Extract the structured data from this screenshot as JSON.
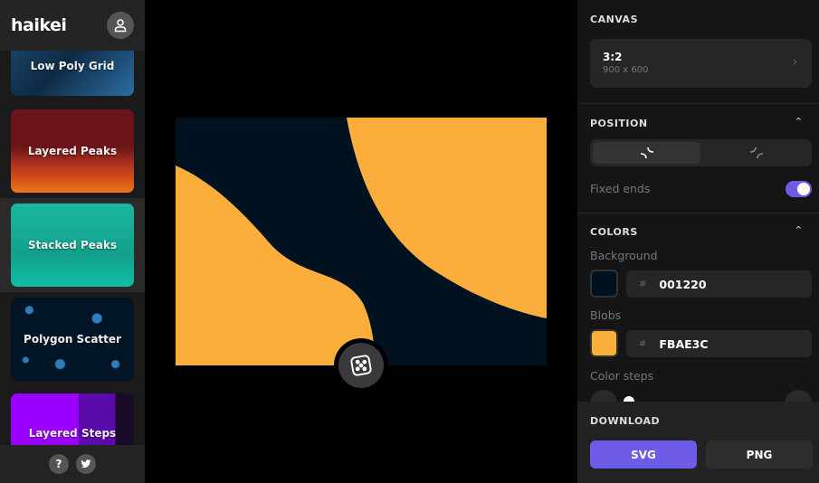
{
  "app": {
    "logo": "haikei"
  },
  "sidebar": {
    "items": [
      {
        "label": "Low Poly Grid"
      },
      {
        "label": "Layered Peaks"
      },
      {
        "label": "Stacked Peaks"
      },
      {
        "label": "Polygon Scatter"
      },
      {
        "label": "Layered Steps"
      }
    ],
    "help": "?"
  },
  "panel": {
    "canvas": {
      "title": "CANVAS",
      "ratio": "3:2",
      "size": "900 x 600"
    },
    "position": {
      "title": "POSITION",
      "fixed_ends": "Fixed ends",
      "fixed_ends_on": true
    },
    "colors": {
      "title": "COLORS",
      "background_label": "Background",
      "background": "001220",
      "blobs_label": "Blobs",
      "blobs": "FBAE3C",
      "steps_label": "Color steps",
      "hash": "#"
    },
    "download": {
      "title": "DOWNLOAD",
      "svg": "SVG",
      "png": "PNG"
    }
  },
  "colors": {
    "accent": "#6c5ce7",
    "bg": "#001220",
    "blob": "#FBAE3C"
  }
}
